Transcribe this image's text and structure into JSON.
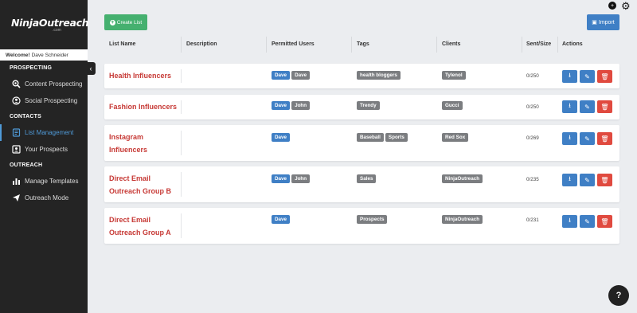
{
  "app": {
    "logo": "NinjaOutreach",
    "logo_sub": ".com",
    "welcome_label": "Welcome!",
    "user_name": "Dave Schneider"
  },
  "sidebar": {
    "sections": [
      {
        "title": "PROSPECTING",
        "items": [
          {
            "label": "Content Prospecting",
            "icon": "magnifier-icon"
          },
          {
            "label": "Social Prospecting",
            "icon": "social-icon"
          }
        ]
      },
      {
        "title": "CONTACTS",
        "items": [
          {
            "label": "List Management",
            "icon": "book-icon",
            "active": true
          },
          {
            "label": "Your Prospects",
            "icon": "contact-card-icon"
          }
        ]
      },
      {
        "title": "OUTREACH",
        "items": [
          {
            "label": "Manage Templates",
            "icon": "templates-icon"
          },
          {
            "label": "Outreach Mode",
            "icon": "paper-plane-icon"
          }
        ]
      }
    ]
  },
  "toolbar": {
    "create_label": "Create List",
    "import_label": "Import"
  },
  "table": {
    "headers": {
      "list_name": "List Name",
      "description": "Description",
      "permitted_users": "Permitted Users",
      "tags": "Tags",
      "clients": "Clients",
      "sent_size": "Sent/Size",
      "actions": "Actions"
    },
    "rows": [
      {
        "name_lines": [
          "Health Influencers"
        ],
        "users": [
          "Dave",
          "Dave"
        ],
        "tags": [
          "health bloggers"
        ],
        "clients": [
          "Tylenol"
        ],
        "sent": "0/250"
      },
      {
        "name_lines": [
          "Fashion Influencers"
        ],
        "users": [
          "Dave",
          "John"
        ],
        "tags": [
          "Trendy"
        ],
        "clients": [
          "Gucci"
        ],
        "sent": "0/250"
      },
      {
        "name_lines": [
          "Instagram",
          "Influencers"
        ],
        "users": [
          "Dave"
        ],
        "tags": [
          "Baseball",
          "Sports"
        ],
        "clients": [
          "Red Sox"
        ],
        "sent": "0/269"
      },
      {
        "name_lines": [
          "Direct Email",
          "Outreach Group B"
        ],
        "users": [
          "Dave",
          "John"
        ],
        "tags": [
          "Sales"
        ],
        "clients": [
          "NinjaOutreach"
        ],
        "sent": "0/235"
      },
      {
        "name_lines": [
          "Direct Email",
          "Outreach Group A"
        ],
        "users": [
          "Dave"
        ],
        "tags": [
          "Prospects"
        ],
        "clients": [
          "NinjaOutreach"
        ],
        "sent": "0/231"
      }
    ]
  },
  "colors": {
    "sidebar_bg": "#242424",
    "accent_blue": "#3f7fc5",
    "create_green": "#45b06f",
    "list_name_red": "#c73a36",
    "delete_red": "#e04a3f",
    "pill_gray": "#7b7d80"
  }
}
